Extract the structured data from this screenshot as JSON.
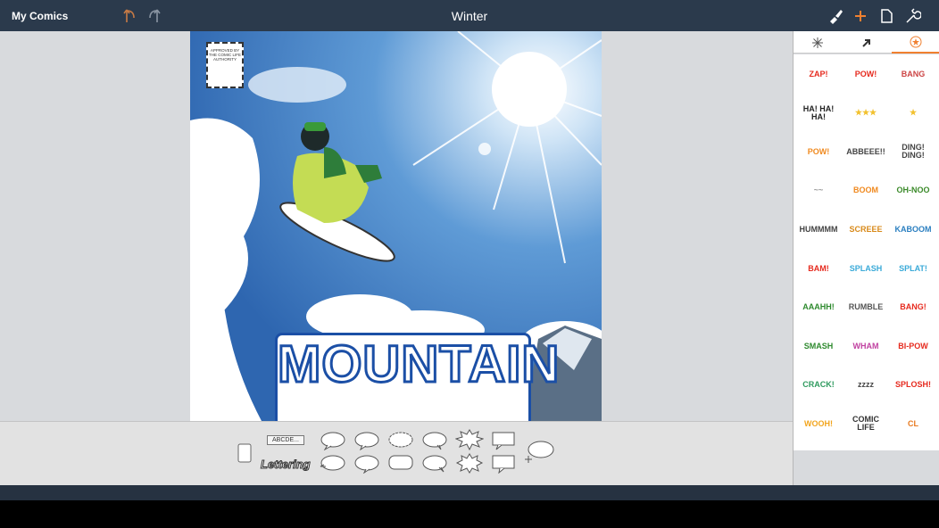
{
  "topbar": {
    "back_label": "My Comics",
    "title": "Winter"
  },
  "page": {
    "title_line1": "MOUNTAIN",
    "stamp_text": "APPROVED BY THE COMIC LIFE AUTHORITY"
  },
  "tray": {
    "caption_sample": "ABCDE...",
    "lettering_sample": "Lettering"
  },
  "panel": {
    "tabs": [
      "snowflake-tab",
      "arrow-tab",
      "star-tab"
    ],
    "stickers": [
      {
        "text": "ZAP!",
        "color": "#e62a1e"
      },
      {
        "text": "POW!",
        "color": "#e62a1e"
      },
      {
        "text": "BANG",
        "color": "#c44"
      },
      {
        "text": "HA! HA! HA!",
        "color": "#222"
      },
      {
        "text": "★★★",
        "color": "#f2c12e"
      },
      {
        "text": "★",
        "color": "#f2c12e"
      },
      {
        "text": "POW!",
        "color": "#f08a20"
      },
      {
        "text": "ABBEEE!!",
        "color": "#444"
      },
      {
        "text": "DING! DING!",
        "color": "#444"
      },
      {
        "text": "~~",
        "color": "#999"
      },
      {
        "text": "BOOM",
        "color": "#f08a20"
      },
      {
        "text": "OH-NOO",
        "color": "#3b8a2a"
      },
      {
        "text": "HUMMMM",
        "color": "#444"
      },
      {
        "text": "SCREEE",
        "color": "#d88a1a"
      },
      {
        "text": "KABOOM",
        "color": "#2b7fc0"
      },
      {
        "text": "BAM!",
        "color": "#e62a1e"
      },
      {
        "text": "SPLASH",
        "color": "#3aaad8"
      },
      {
        "text": "SPLAT!",
        "color": "#3aaad8"
      },
      {
        "text": "AAAHH!",
        "color": "#2e8a2e"
      },
      {
        "text": "RUMBLE",
        "color": "#555"
      },
      {
        "text": "BANG!",
        "color": "#e62a1e"
      },
      {
        "text": "SMASH",
        "color": "#2e8a2e"
      },
      {
        "text": "WHAM",
        "color": "#c040a0"
      },
      {
        "text": "BI-POW",
        "color": "#e62a1e"
      },
      {
        "text": "CRACK!",
        "color": "#2e9a5e"
      },
      {
        "text": "zzzz",
        "color": "#444"
      },
      {
        "text": "SPLOSH!",
        "color": "#e62a1e"
      },
      {
        "text": "WOOH!",
        "color": "#f2a51e"
      },
      {
        "text": "COMIC LIFE",
        "color": "#333"
      },
      {
        "text": "CL",
        "color": "#e87a20"
      }
    ]
  },
  "colors": {
    "topbar": "#2b3a4c",
    "accent": "#f08030"
  }
}
